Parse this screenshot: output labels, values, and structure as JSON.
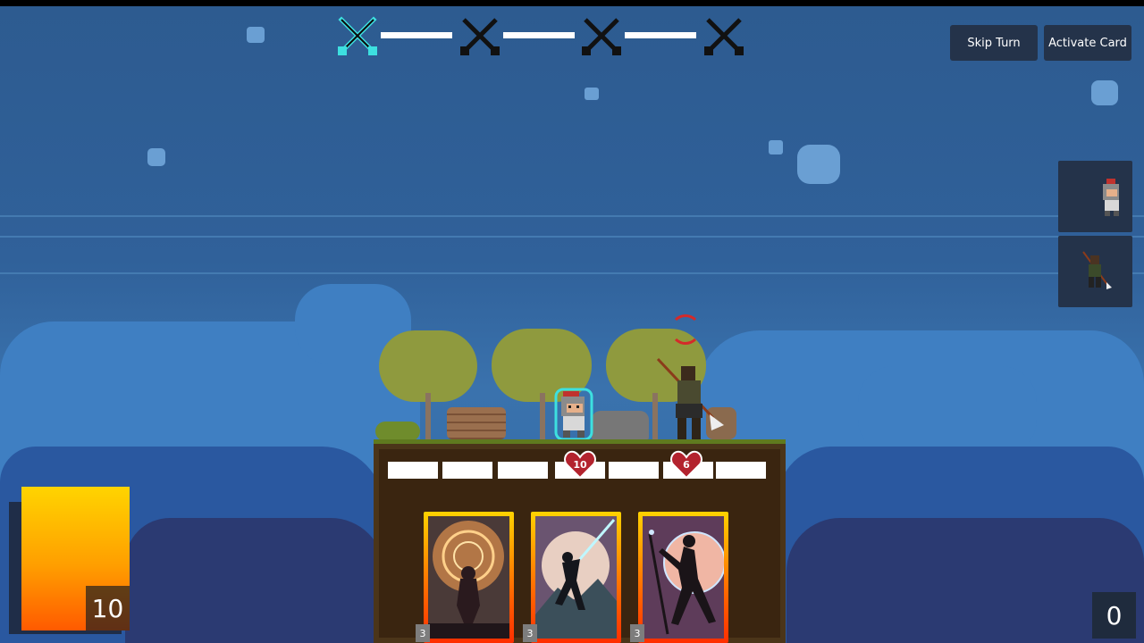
{
  "battle_progress": {
    "nodes": [
      {
        "icon": "crossed-swords-icon",
        "state": "current",
        "color": "#3de0e0"
      },
      {
        "icon": "crossed-swords-icon",
        "state": "upcoming",
        "color": "#111111"
      },
      {
        "icon": "crossed-swords-icon",
        "state": "upcoming",
        "color": "#111111"
      },
      {
        "icon": "crossed-swords-icon",
        "state": "upcoming",
        "color": "#111111"
      }
    ]
  },
  "buttons": {
    "skip_turn": "Skip Turn",
    "activate_card": "Activate Card"
  },
  "turn_queue": [
    {
      "unit": "knight",
      "icon": "knight-icon"
    },
    {
      "unit": "spearman",
      "icon": "spearman-icon"
    }
  ],
  "units": {
    "player": {
      "name": "knight",
      "health": 10,
      "highlight_color": "#3de0e0"
    },
    "enemy": {
      "name": "spearman",
      "health": 6,
      "targeted": true,
      "target_color": "#d42a2a"
    }
  },
  "hand": [
    {
      "cost": "3",
      "art": "swirling-energy-mage-icon"
    },
    {
      "cost": "3",
      "art": "lightsaber-warrior-icon"
    },
    {
      "cost": "3",
      "art": "staff-wielder-icon"
    }
  ],
  "energy": {
    "value": "10",
    "color_top": "#ffd400",
    "color_bottom": "#ff5a00"
  },
  "deck_count": "0"
}
